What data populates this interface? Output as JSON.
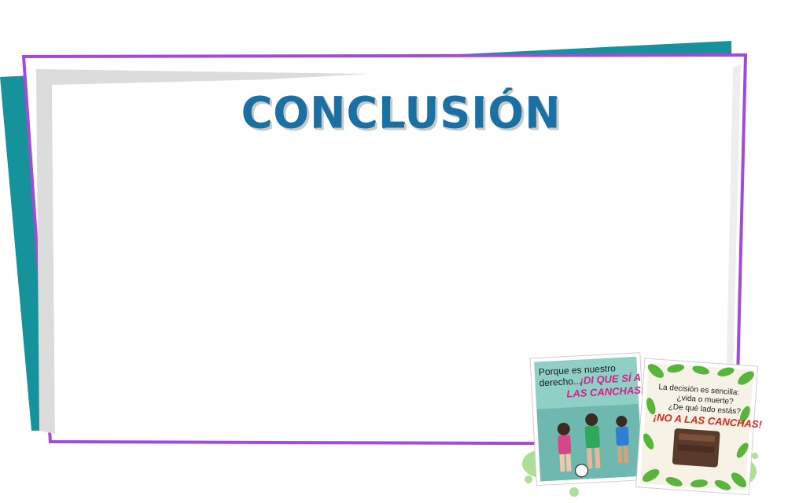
{
  "slide": {
    "title": "CONCLUSIÓN"
  },
  "posters": {
    "left": {
      "line1": "Porque es nuestro",
      "line2": "derecho...",
      "slogan1": "¡DI QUE SÍ A",
      "slogan2": "LAS CANCHAS!"
    },
    "right": {
      "line1": "La decisión es sencilla:",
      "line2": "¿vida o muerte?",
      "line3": "¿De qué lado estás?",
      "slogan": "¡NO A LAS CANCHAS!"
    }
  },
  "colors": {
    "teal": "#16939a",
    "purple": "#a24bdb",
    "title_blue": "#1a6fa3",
    "gray_paper": "#e1e1e1"
  }
}
